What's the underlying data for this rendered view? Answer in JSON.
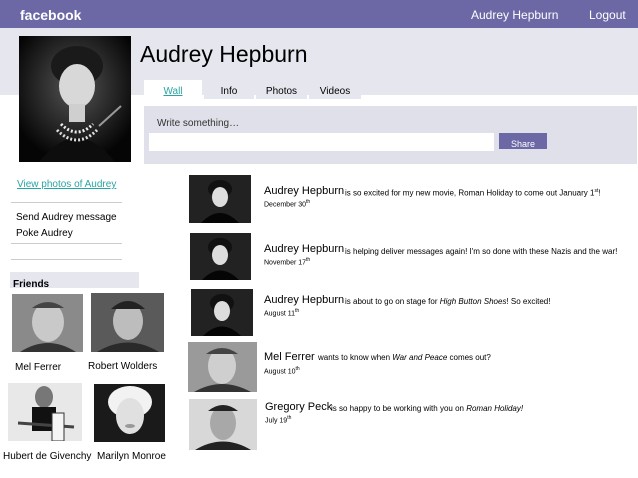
{
  "topbar": {
    "brand": "facebook",
    "user_name": "Audrey Hepburn",
    "logout": "Logout"
  },
  "profile": {
    "name": "Audrey Hepburn"
  },
  "tabs": [
    {
      "label": "Wall",
      "active": true
    },
    {
      "label": "Info"
    },
    {
      "label": "Photos"
    },
    {
      "label": "Videos"
    }
  ],
  "compose": {
    "prompt": "Write something…",
    "value": "",
    "share_label": "Share"
  },
  "sidebar": {
    "view_photos": "View photos of Audrey",
    "send_message": "Send Audrey message",
    "poke": "Poke Audrey"
  },
  "friends": {
    "title": "Friends",
    "items": [
      {
        "name": "Mel Ferrer"
      },
      {
        "name": "Robert Wolders"
      },
      {
        "name": "Hubert de Givenchy"
      },
      {
        "name": "Marilyn Monroe"
      }
    ]
  },
  "feed": [
    {
      "author": "Audrey Hepburn",
      "text": "is so excited for my new movie, Roman Holiday to come out January 1",
      "text_sup": "st",
      "text_end": "!",
      "date": "December 30",
      "date_sup": "th"
    },
    {
      "author": "Audrey Hepburn",
      "text": "is helping deliver messages again! I'm so done with these Nazis and the war!",
      "date": "November 17",
      "date_sup": "th"
    },
    {
      "author": "Audrey Hepburn",
      "text_pre": "is about to go on stage for ",
      "text_em": "High Button Shoes",
      "text_post": "! So excited!",
      "date": "August 11",
      "date_sup": "th"
    },
    {
      "author": "Mel Ferrer",
      "text_pre": "wants to know when ",
      "text_em": "War and Peace",
      "text_post": " comes out?",
      "date": "August 10",
      "date_sup": "th"
    },
    {
      "author": "Gregory Peck",
      "text_pre": "is so happy to be working with you on ",
      "text_em": "Roman Holiday!",
      "text_post": "",
      "date": "July 19",
      "date_sup": "th"
    }
  ]
}
